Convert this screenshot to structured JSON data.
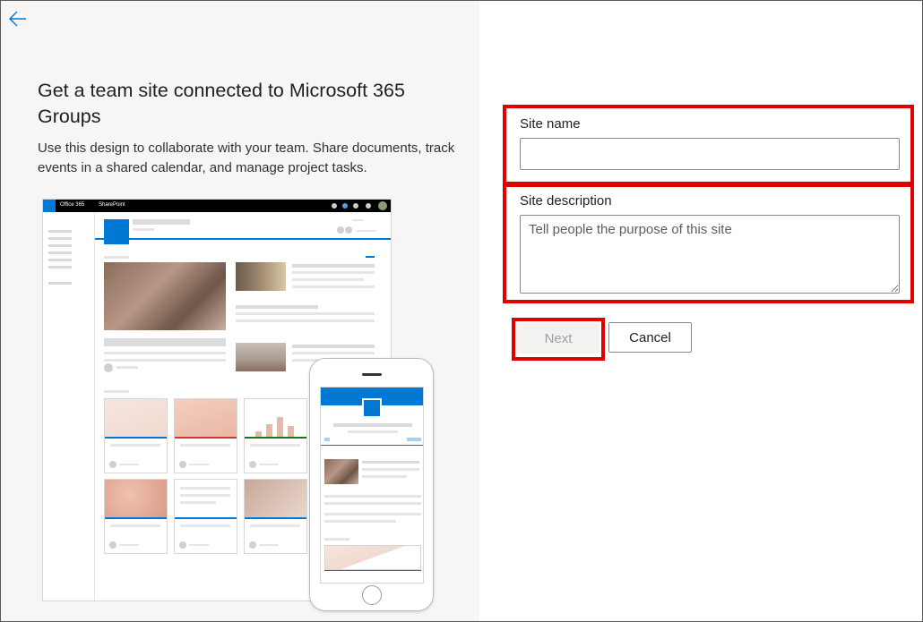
{
  "page": {
    "title": "Get a team site connected to Microsoft 365 Groups",
    "description": "Use this design to collaborate with your team. Share documents, track events in a shared calendar, and manage project tasks.",
    "back_icon": "arrow-left-icon"
  },
  "preview": {
    "suite_label": "Office 365",
    "app_label": "SharePoint"
  },
  "form": {
    "site_name_label": "Site name",
    "site_name_value": "",
    "site_description_label": "Site description",
    "site_description_placeholder": "Tell people the purpose of this site",
    "next_label": "Next",
    "cancel_label": "Cancel"
  },
  "colors": {
    "accent": "#0078d4",
    "highlight": "#e00000",
    "disabled_text": "#a19f9d"
  }
}
